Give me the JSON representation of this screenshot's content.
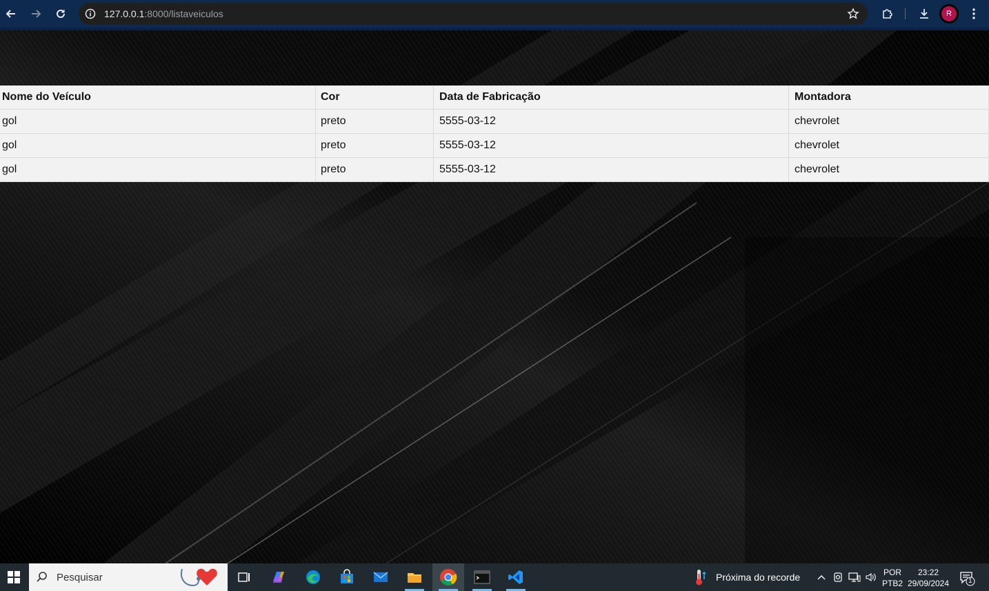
{
  "browser": {
    "url_host": "127.0.0.1",
    "url_path": ":8000/listaveiculos",
    "profile_initial": "R"
  },
  "table": {
    "headers": [
      "Nome do Veículo",
      "Cor",
      "Data de Fabricação",
      "Montadora"
    ],
    "rows": [
      [
        "gol",
        "preto",
        "5555-03-12",
        "chevrolet"
      ],
      [
        "gol",
        "preto",
        "5555-03-12",
        "chevrolet"
      ],
      [
        "gol",
        "preto",
        "5555-03-12",
        "chevrolet"
      ]
    ]
  },
  "taskbar": {
    "search_placeholder": "Pesquisar",
    "weather_text": "Próxima do recorde",
    "lang_top": "POR",
    "lang_bottom": "PTB2",
    "time": "23:22",
    "date": "29/09/2024",
    "notification_count": "1"
  },
  "colors": {
    "browser_bar": "#0e2a4f",
    "omnibox": "#1f1f1f",
    "table_bg": "#f2f2f2",
    "taskbar": "#202a30",
    "profile": "#b0134d"
  }
}
